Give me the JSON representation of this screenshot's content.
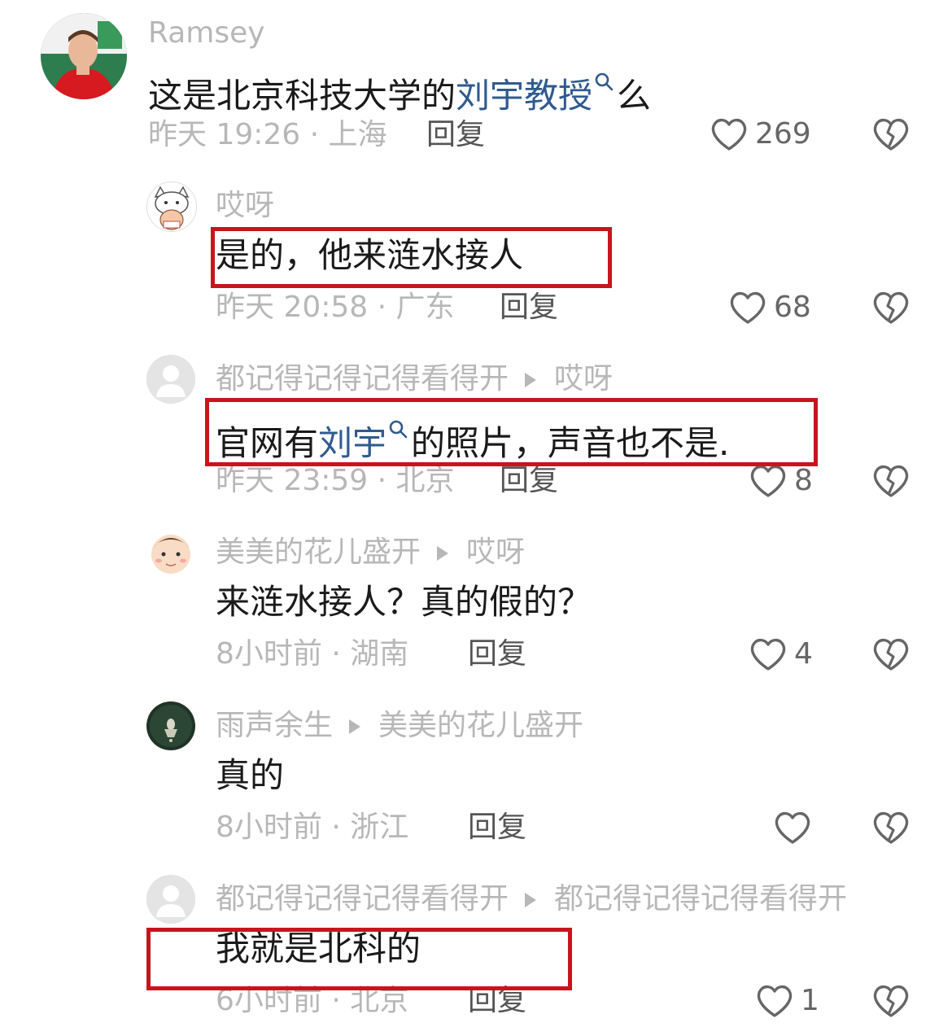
{
  "comments": [
    {
      "username": "Ramsey",
      "text_before": "这是北京科技大学的",
      "link_text": "刘宇教授",
      "text_after": "么",
      "meta": "昨天 19:26 · 上海",
      "reply_label": "回复",
      "likes": "269"
    },
    {
      "username": "哎呀",
      "text": "是的，他来涟水接人",
      "meta": "昨天 20:58 · 广东",
      "reply_label": "回复",
      "likes": "68"
    },
    {
      "username": "都记得记得记得看得开",
      "reply_to": "哎呀",
      "text_before": "官网有",
      "link_text": "刘宇",
      "text_after": "的照片，声音也不是.",
      "meta": "昨天 23:59 · 北京",
      "reply_label": "回复",
      "likes": "8"
    },
    {
      "username": "美美的花儿盛开",
      "reply_to": "哎呀",
      "text": "来涟水接人？真的假的？",
      "meta": "8小时前 · 湖南",
      "reply_label": "回复",
      "likes": "4"
    },
    {
      "username": "雨声余生",
      "reply_to": "美美的花儿盛开",
      "text": "真的",
      "meta": "8小时前 · 浙江",
      "reply_label": "回复",
      "likes": ""
    },
    {
      "username": "都记得记得记得看得开",
      "reply_to": "都记得记得记得看得开",
      "text": "我就是北科的",
      "meta": "6小时前 · 北京",
      "reply_label": "回复",
      "likes": "1"
    }
  ],
  "colors": {
    "link": "#2f5a8f",
    "highlight_box": "#c8141e",
    "muted_text": "#b7b7b7"
  },
  "icons": {
    "like": "heart-outline-icon",
    "dislike": "broken-heart-icon",
    "search_link": "search-icon"
  }
}
